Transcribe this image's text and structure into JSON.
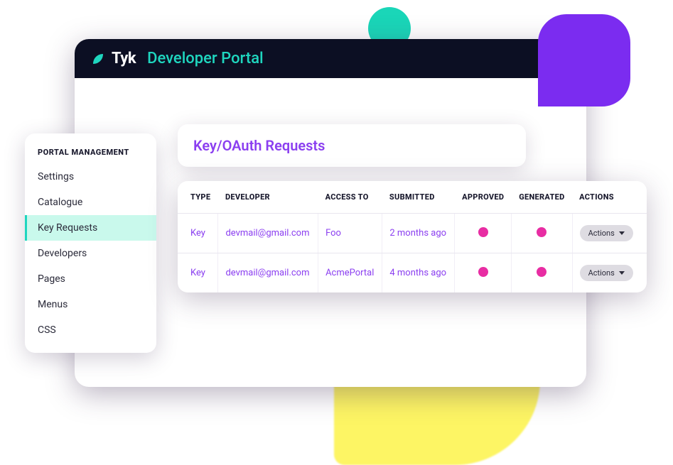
{
  "header": {
    "logo_text": "Tyk",
    "logo_sub": "Developer Portal"
  },
  "page_title": "Key/OAuth Requests",
  "sidebar": {
    "title": "PORTAL MANAGEMENT",
    "items": [
      {
        "label": "Settings",
        "active": false
      },
      {
        "label": "Catalogue",
        "active": false
      },
      {
        "label": "Key Requests",
        "active": true
      },
      {
        "label": "Developers",
        "active": false
      },
      {
        "label": "Pages",
        "active": false
      },
      {
        "label": "Menus",
        "active": false
      },
      {
        "label": "CSS",
        "active": false
      }
    ]
  },
  "table": {
    "headers": {
      "type": "TYPE",
      "developer": "DEVELOPER",
      "access_to": "ACCESS TO",
      "submitted": "SUBMITTED",
      "approved": "APPROVED",
      "generated": "GENERATED",
      "actions": "ACTIONS"
    },
    "action_button_label": "Actions",
    "rows": [
      {
        "type": "Key",
        "developer": "devmail@gmail.com",
        "access_to": "Foo",
        "submitted": "2 months ago"
      },
      {
        "type": "Key",
        "developer": "devmail@gmail.com",
        "access_to": "AcmePortal",
        "submitted": "4 months ago"
      }
    ]
  },
  "colors": {
    "accent_purple": "#8b3ff0",
    "accent_teal": "#1fd6bf",
    "status_pink": "#e82da3"
  }
}
